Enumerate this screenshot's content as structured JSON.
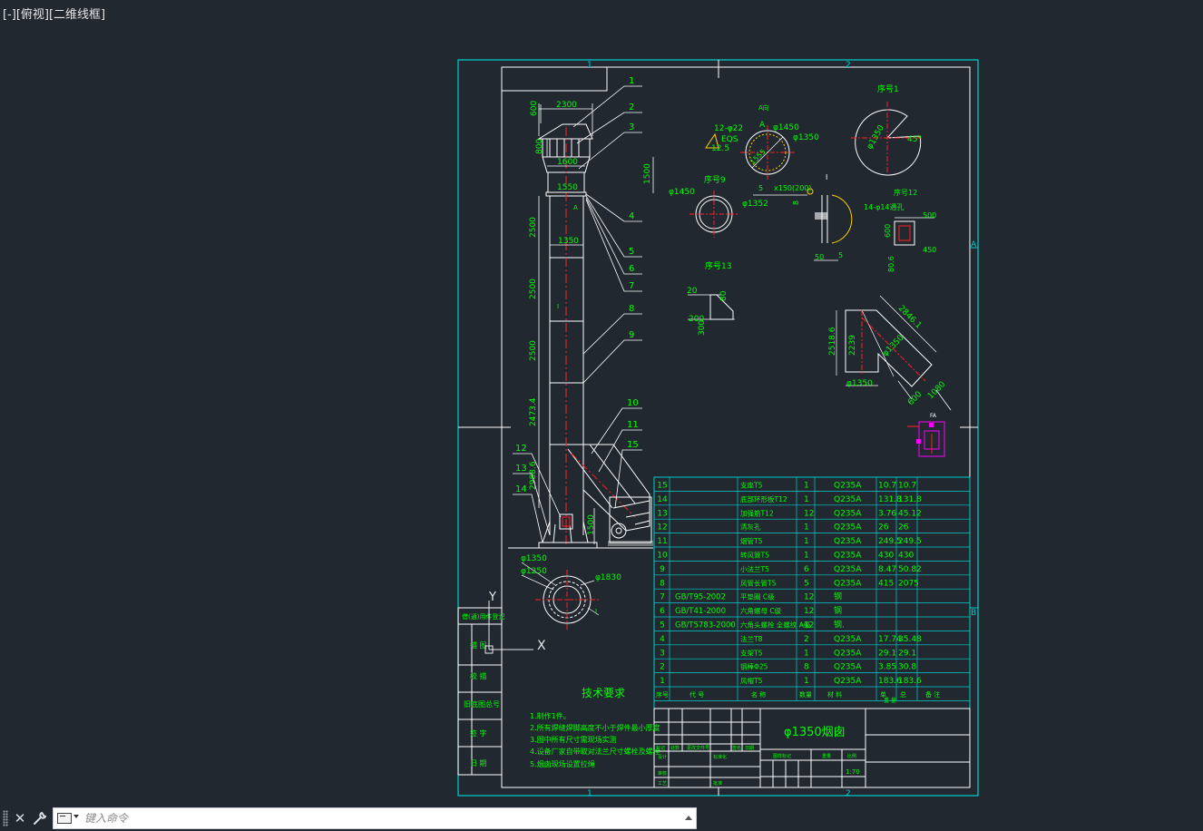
{
  "viewport": {
    "label": "[-][俯视][二维线框]"
  },
  "colors": {
    "background": "#212830",
    "frame": "#00d0d0",
    "text": "#00ff00",
    "lines": "#ffffff",
    "red": "#ff2020",
    "magenta": "#ff00ff",
    "yellow": "#ffd000"
  },
  "sheet": {
    "zones": {
      "top_1": "1",
      "top_2": "2",
      "bottom_1": "1",
      "bottom_2": "2",
      "right_a": "A",
      "right_b": "B"
    },
    "left_strip": [
      "借(通)用件登记",
      "描 图",
      "校 描",
      "旧底图总号",
      "签 字",
      "日 期"
    ],
    "tech_title": "技术要求",
    "tech_notes": [
      "1.制作1件。",
      "2.所有焊缝焊脚高度不小于焊件最小厚度",
      "3.图中所有尺寸需现场实测",
      "4.设备厂家自带取对法兰尺寸螺栓及螺栓",
      "5.烟囱现场设置拉绳"
    ],
    "title_block": {
      "title": "φ1350烟囱",
      "header": [
        "序号",
        "代 号",
        "名 称",
        "数量",
        "材 料",
        "单",
        "总",
        "备 注"
      ],
      "weight_header": "重 量",
      "scale": "1:70",
      "sign_labels": [
        "标记",
        "处数",
        "更改文件号",
        "签名",
        "日期",
        "设计",
        "标准化",
        "审核",
        "工艺",
        "批准",
        "图样标记",
        "重量",
        "比例"
      ]
    }
  },
  "parts_table": [
    {
      "no": "15",
      "code": "",
      "name": "支座T5",
      "qty": "1",
      "mat": "Q235A",
      "unit": "10.7",
      "total": "10.7"
    },
    {
      "no": "14",
      "code": "",
      "name": "底部环形板T12",
      "qty": "1",
      "mat": "Q235A",
      "unit": "131.8",
      "total": "131.8"
    },
    {
      "no": "13",
      "code": "",
      "name": "加强筋T12",
      "qty": "12",
      "mat": "Q235A",
      "unit": "3.76",
      "total": "45.12"
    },
    {
      "no": "12",
      "code": "",
      "name": "清灰孔",
      "qty": "1",
      "mat": "Q235A",
      "unit": "26",
      "total": "26"
    },
    {
      "no": "11",
      "code": "",
      "name": "烟管T5",
      "qty": "1",
      "mat": "Q235A",
      "unit": "249.5",
      "total": "249.5"
    },
    {
      "no": "10",
      "code": "",
      "name": "转风管T5",
      "qty": "1",
      "mat": "Q235A",
      "unit": "430",
      "total": "430"
    },
    {
      "no": "9",
      "code": "",
      "name": "小法兰T5",
      "qty": "6",
      "mat": "Q235A",
      "unit": "8.47",
      "total": "50.82"
    },
    {
      "no": "8",
      "code": "",
      "name": "风管长管T5",
      "qty": "5",
      "mat": "Q235A",
      "unit": "415",
      "total": "2075"
    },
    {
      "no": "7",
      "code": "GB/T95-2002",
      "name": "平垫圈 C级",
      "qty": "12",
      "mat": "钢",
      "unit": "",
      "total": ""
    },
    {
      "no": "6",
      "code": "GB/T41-2000",
      "name": "六角螺母 C级",
      "qty": "12",
      "mat": "钢",
      "unit": "",
      "total": ""
    },
    {
      "no": "5",
      "code": "GB/T5783-2000",
      "name": "六角头螺栓 全螺纹 A级",
      "qty": "12",
      "mat": "钢.",
      "unit": "",
      "total": ""
    },
    {
      "no": "4",
      "code": "",
      "name": "法兰T8",
      "qty": "2",
      "mat": "Q235A",
      "unit": "17.74",
      "total": "35.48"
    },
    {
      "no": "3",
      "code": "",
      "name": "支架T5",
      "qty": "1",
      "mat": "Q235A",
      "unit": "29.1",
      "total": "29.1"
    },
    {
      "no": "2",
      "code": "",
      "name": "钢棒Φ25",
      "qty": "8",
      "mat": "Q235A",
      "unit": "3.85",
      "total": "30.8"
    },
    {
      "no": "1",
      "code": "",
      "name": "风帽T5",
      "qty": "1",
      "mat": "Q235A",
      "unit": "183.6",
      "total": "183.6"
    }
  ],
  "dims": {
    "cap_width": "2300",
    "cap_height": "600",
    "cap_side": "800",
    "cap_inner": "1600",
    "cap_drop": "1500",
    "flange_w": "1550",
    "flange_mark": "A",
    "pipe_w": "1350",
    "seg1": "2500",
    "seg2": "2500",
    "seg3": "2500",
    "seg4": "2473.4",
    "seg5": "2988.6",
    "base_h": "1500",
    "sec_i": "I",
    "bottom_phi1": "φ1350",
    "bottom_phi2": "φ1250",
    "bottom_phi3": "φ1830",
    "bottom_i": "I",
    "balloons": [
      "1",
      "2",
      "3",
      "4",
      "5",
      "6",
      "7",
      "8",
      "9",
      "10",
      "11",
      "12",
      "13",
      "14",
      "15"
    ],
    "detA_label": "A向",
    "detA_phi1": "φ1450",
    "detA_phi2": "φ1350",
    "detA_holes": "12-φ22",
    "detA_eq": "EQS",
    "detA_r": "12.5",
    "detA_a": "A",
    "detA_len": "1555",
    "detI_label": "I",
    "detI_weld": "5",
    "detI_wv": "x150(200)",
    "detI_w": "50",
    "detI_t": "5",
    "detI_h": "8",
    "p1_label": "序号1",
    "p1_d": "φ1350",
    "p1_a": "45°",
    "p9_label": "序号9",
    "p9_phi1": "φ1450",
    "p9_phi2": "φ1352",
    "p12_label": "序号12",
    "p12_holes": "14-φ14通孔",
    "p12_w": "500",
    "p12_h": "600",
    "p12_i": "450",
    "p12_s": "80.6",
    "p13_label": "序号13",
    "p13_a": "20",
    "p13_b": "80",
    "p13_c": "200",
    "p13_d": "300",
    "elbow_len": "2846.1",
    "elbow_h1": "2518.6",
    "elbow_h2": "2239",
    "elbow_d": "φ1350",
    "elbow_b": "φ1350",
    "elbow_w1": "600",
    "elbow_w2": "1080",
    "ucs_x": "X",
    "ucs_y": "Y",
    "fa_label": "FA"
  },
  "command": {
    "placeholder": "键入命令"
  }
}
